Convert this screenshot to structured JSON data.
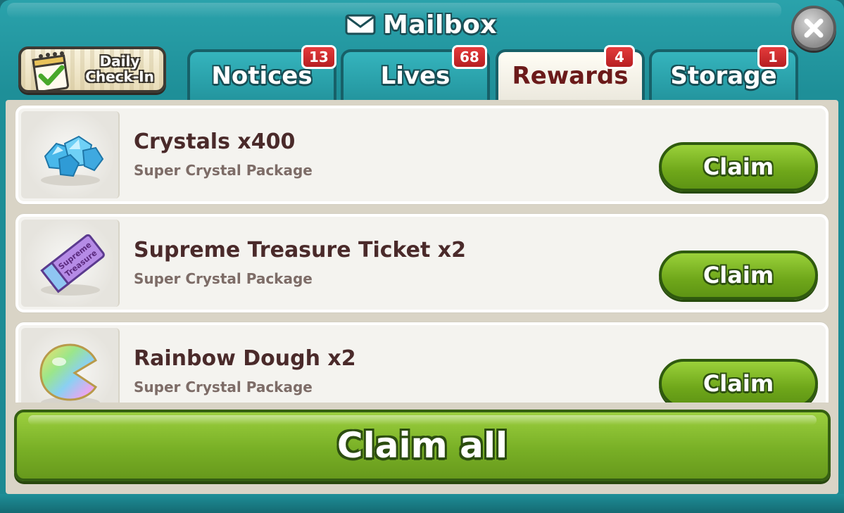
{
  "window": {
    "title": "Mailbox",
    "title_icon": "envelope-icon"
  },
  "close_button": {
    "icon": "close-icon"
  },
  "daily_checkin": {
    "line1": "Daily",
    "line2": "Check-In",
    "icon": "calendar-check-icon"
  },
  "tabs": [
    {
      "label": "Notices",
      "badge": "13",
      "active": false
    },
    {
      "label": "Lives",
      "badge": "68",
      "active": false
    },
    {
      "label": "Rewards",
      "badge": "4",
      "active": true
    },
    {
      "label": "Storage",
      "badge": "1",
      "active": false
    }
  ],
  "rewards": [
    {
      "title": "Crystals x400",
      "subtitle": "Super Crystal Package",
      "icon": "crystals-icon",
      "button": "Claim"
    },
    {
      "title": "Supreme Treasure Ticket x2",
      "subtitle": "Super Crystal Package",
      "icon": "treasure-ticket-icon",
      "button": "Claim",
      "ticket_text_1": "Supreme",
      "ticket_text_2": "Treasure"
    },
    {
      "title": "Rainbow Dough x2",
      "subtitle": "Super Crystal Package",
      "icon": "rainbow-dough-icon",
      "button": "Claim"
    }
  ],
  "claim_all": {
    "label": "Claim all"
  },
  "colors": {
    "frame_teal": "#1e8f98",
    "accent_green": "#79b026",
    "badge_red": "#d32f2f",
    "active_tab_text": "#6b1a1a"
  }
}
